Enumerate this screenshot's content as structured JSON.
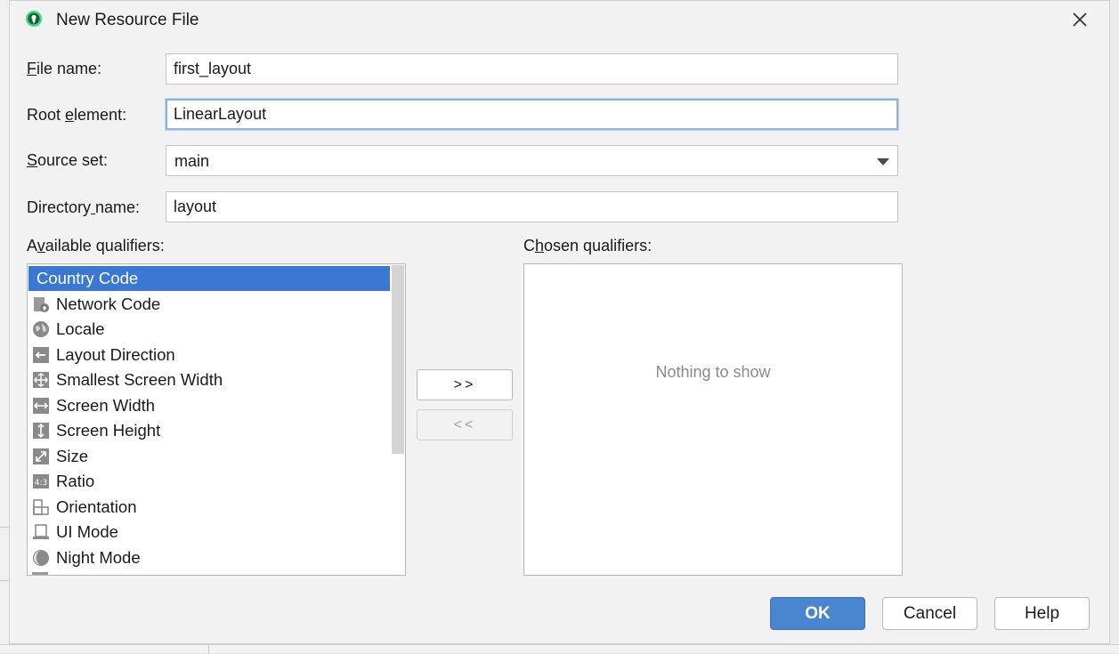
{
  "dialog": {
    "title": "New Resource File",
    "colors": {
      "accent": "#3a78d4",
      "primary_button": "#4a86cf"
    }
  },
  "form": {
    "file_name": {
      "label_mnemonic": "F",
      "label_rest": "ile name:",
      "value": "first_layout"
    },
    "root_element": {
      "label_pre": "Root ",
      "label_mnemonic": "e",
      "label_rest": "lement:",
      "value": "LinearLayout"
    },
    "source_set": {
      "label_mnemonic": "S",
      "label_rest": "ource set:",
      "value": "main"
    },
    "directory_name": {
      "label_pre": "Directory",
      "label_mnemonic": " ",
      "label_rest": "name:",
      "value": "layout"
    }
  },
  "available": {
    "label_pre": "A",
    "label_mnemonic": "v",
    "label_rest": "ailable qualifiers:",
    "items": [
      {
        "label": "Country Code",
        "icon": "country-code-icon"
      },
      {
        "label": "Network Code",
        "icon": "network-code-icon"
      },
      {
        "label": "Locale",
        "icon": "globe-icon"
      },
      {
        "label": "Layout Direction",
        "icon": "layout-direction-icon"
      },
      {
        "label": "Smallest Screen Width",
        "icon": "smallest-width-icon"
      },
      {
        "label": "Screen Width",
        "icon": "screen-width-icon"
      },
      {
        "label": "Screen Height",
        "icon": "screen-height-icon"
      },
      {
        "label": "Size",
        "icon": "size-icon"
      },
      {
        "label": "Ratio",
        "icon": "ratio-icon"
      },
      {
        "label": "Orientation",
        "icon": "orientation-icon"
      },
      {
        "label": "UI Mode",
        "icon": "ui-mode-icon"
      },
      {
        "label": "Night Mode",
        "icon": "night-mode-icon"
      }
    ]
  },
  "chosen": {
    "label_pre": "C",
    "label_mnemonic": "h",
    "label_rest": "osen qualifiers:",
    "empty_text": "Nothing to show"
  },
  "transfer": {
    "add_label": ">>",
    "remove_label": "<<"
  },
  "buttons": {
    "ok": "OK",
    "cancel": "Cancel",
    "help": "Help"
  }
}
